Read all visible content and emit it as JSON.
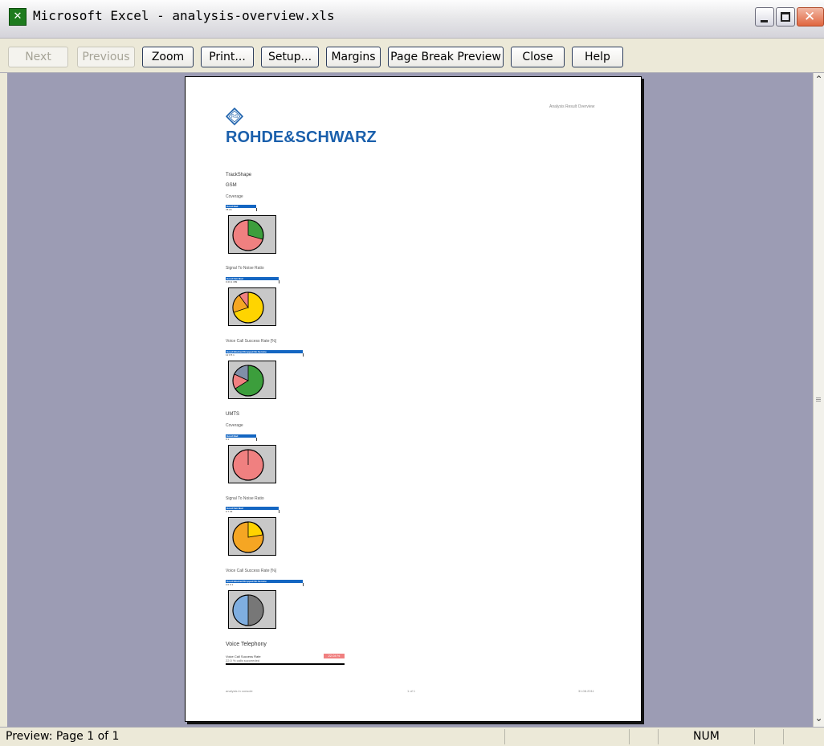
{
  "window": {
    "title": "Microsoft Excel - analysis-overview.xls",
    "app_icon": "excel-icon"
  },
  "toolbar": {
    "next": "Next",
    "previous": "Previous",
    "zoom": "Zoom",
    "print": "Print...",
    "setup": "Setup...",
    "margins": "Margins",
    "page_break_preview": "Page Break Preview",
    "close": "Close",
    "help": "Help"
  },
  "page": {
    "header_right": "Analysis Result Overview",
    "logo_text": "ROHDE&SCHWARZ",
    "logo_mark": "RS",
    "track_shape": "TrackShape",
    "sections": [
      {
        "tech": "GSM",
        "charts": [
          {
            "title": "Coverage",
            "legend": "Good Bad",
            "values": "78  24"
          },
          {
            "title": "Signal To Noise Ratio",
            "legend": "Good Fair   Bad",
            "values": "0  23.1  189"
          },
          {
            "title": "Voice Call Success Rate [%]",
            "legend": "Good Blocked Dropped No Service",
            "values": "12  0  5  1"
          }
        ]
      },
      {
        "tech": "UMTS",
        "charts": [
          {
            "title": "Coverage",
            "legend": "Good Bad",
            "values": "0  1"
          },
          {
            "title": "Signal To Noise Ratio",
            "legend": "Good Fair   Bad",
            "values": "0  7  23"
          },
          {
            "title": "Voice Call Success Rate [%]",
            "legend": "Good Blocked Dropped No Service",
            "values": "0  0  0  1"
          }
        ]
      }
    ],
    "voice_telephony": {
      "title": "Voice Telephony",
      "row_label": "Voice Call Success Rate",
      "row_sub": "22.0 % calls succeeded",
      "badge": "22.04 %"
    },
    "footer": {
      "left": "analysis in console",
      "center": "1 of 1",
      "right": "31.08.2011"
    }
  },
  "statusbar": {
    "text": "Preview: Page 1 of 1",
    "num": "NUM"
  },
  "colors": {
    "good": "#3c9e3c",
    "bad": "#f08080",
    "fair": "#f5a623",
    "yellow": "#ffd400",
    "blue": "#7faee0",
    "gray": "#777777",
    "brand": "#1b60ac"
  }
}
